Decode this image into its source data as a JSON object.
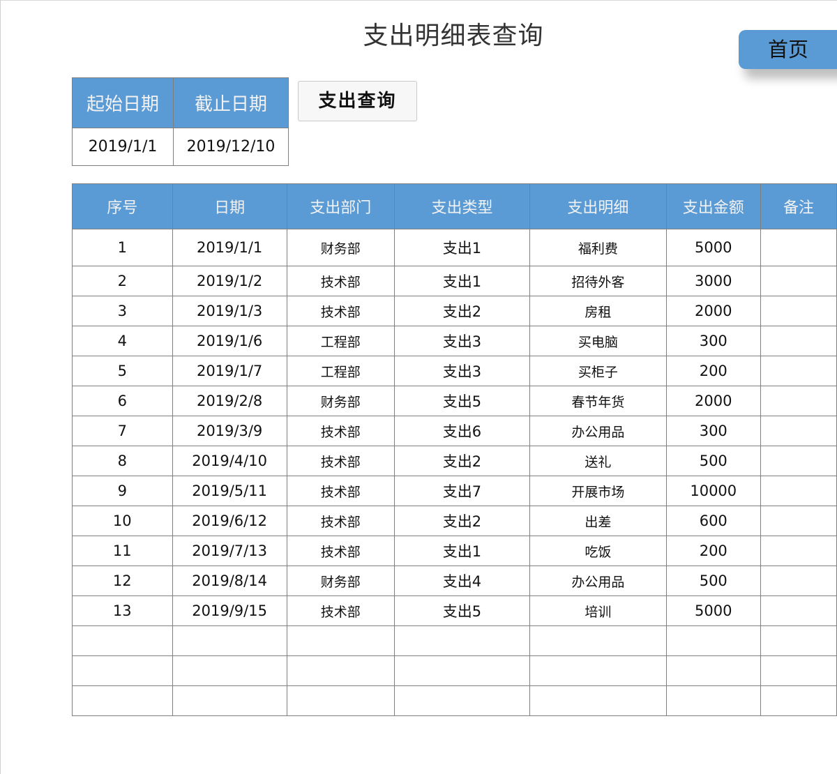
{
  "page": {
    "title": "支出明细表查询",
    "home_label": "首页"
  },
  "filter": {
    "start_label": "起始日期",
    "end_label": "截止日期",
    "start_value": "2019/1/1",
    "end_value": "2019/12/10",
    "query_label": "支出查询"
  },
  "table": {
    "headers": [
      "序号",
      "日期",
      "支出部门",
      "支出类型",
      "支出明细",
      "支出金额",
      "备注"
    ],
    "rows": [
      [
        "1",
        "2019/1/1",
        "财务部",
        "支出1",
        "福利费",
        "5000",
        ""
      ],
      [
        "2",
        "2019/1/2",
        "技术部",
        "支出1",
        "招待外客",
        "3000",
        ""
      ],
      [
        "3",
        "2019/1/3",
        "技术部",
        "支出2",
        "房租",
        "2000",
        ""
      ],
      [
        "4",
        "2019/1/6",
        "工程部",
        "支出3",
        "买电脑",
        "300",
        ""
      ],
      [
        "5",
        "2019/1/7",
        "工程部",
        "支出3",
        "买柜子",
        "200",
        ""
      ],
      [
        "6",
        "2019/2/8",
        "财务部",
        "支出5",
        "春节年货",
        "2000",
        ""
      ],
      [
        "7",
        "2019/3/9",
        "技术部",
        "支出6",
        "办公用品",
        "300",
        ""
      ],
      [
        "8",
        "2019/4/10",
        "技术部",
        "支出2",
        "送礼",
        "500",
        ""
      ],
      [
        "9",
        "2019/5/11",
        "技术部",
        "支出7",
        "开展市场",
        "10000",
        ""
      ],
      [
        "10",
        "2019/6/12",
        "技术部",
        "支出2",
        "出差",
        "600",
        ""
      ],
      [
        "11",
        "2019/7/13",
        "技术部",
        "支出1",
        "吃饭",
        "200",
        ""
      ],
      [
        "12",
        "2019/8/14",
        "财务部",
        "支出4",
        "办公用品",
        "500",
        ""
      ],
      [
        "13",
        "2019/9/15",
        "技术部",
        "支出5",
        "培训",
        "5000",
        ""
      ],
      [
        "",
        "",
        "",
        "",
        "",
        "",
        ""
      ],
      [
        "",
        "",
        "",
        "",
        "",
        "",
        ""
      ],
      [
        "",
        "",
        "",
        "",
        "",
        "",
        ""
      ]
    ]
  },
  "colors": {
    "header_blue": "#5b9bd5",
    "grid_line": "#7f7f7f"
  }
}
